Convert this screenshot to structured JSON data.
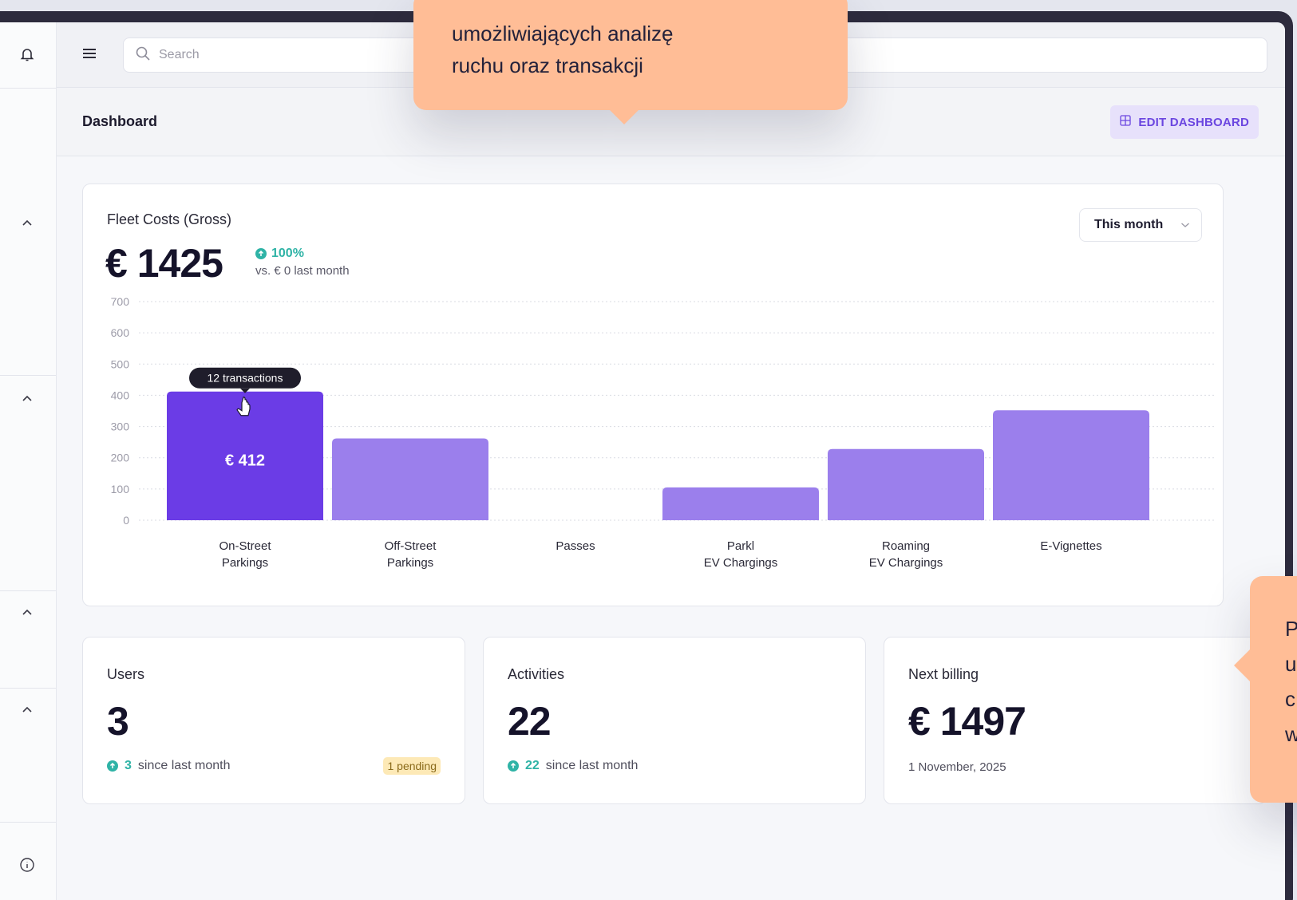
{
  "topbar": {
    "search_placeholder": "Search"
  },
  "header": {
    "title": "Dashboard",
    "edit_button_label": "EDIT DASHBOARD"
  },
  "fleet_costs": {
    "title": "Fleet Costs (Gross)",
    "value": "€ 1425",
    "delta": "100%",
    "delta_sub": "vs. € 0 last month",
    "period": "This month",
    "tooltip": "12 transactions",
    "highlight_label": "€ 412"
  },
  "stats": {
    "users": {
      "title": "Users",
      "value": "3",
      "delta": "3",
      "delta_text": "since last month",
      "badge": "1 pending"
    },
    "activities": {
      "title": "Activities",
      "value": "22",
      "delta": "22",
      "delta_text": "since last month"
    },
    "billing": {
      "title": "Next billing",
      "value": "€ 1497",
      "date": "1 November, 2025"
    }
  },
  "callouts": {
    "top": [
      "umożliwiających analizę",
      "ruchu oraz transakcji"
    ],
    "right": [
      "P",
      "u",
      "c",
      "w"
    ]
  },
  "colors": {
    "accent": "#6b46e0",
    "bar_active": "#6b3ce6",
    "bar": "#9b7fec",
    "positive": "#2fb3a6",
    "callout": "#ffbd96"
  },
  "chart_data": {
    "type": "bar",
    "categories": [
      [
        "On-Street",
        "Parkings"
      ],
      [
        "Off-Street",
        "Parkings"
      ],
      [
        "Passes"
      ],
      [
        "Parkl",
        "EV Chargings"
      ],
      [
        "Roaming",
        "EV Chargings"
      ],
      [
        "E-Vignettes"
      ]
    ],
    "values": [
      412,
      262,
      0,
      105,
      228,
      352
    ],
    "highlight_index": 0,
    "yticks": [
      0,
      100,
      200,
      300,
      400,
      500,
      600,
      700
    ],
    "ylim": [
      0,
      700
    ],
    "grid": true
  }
}
